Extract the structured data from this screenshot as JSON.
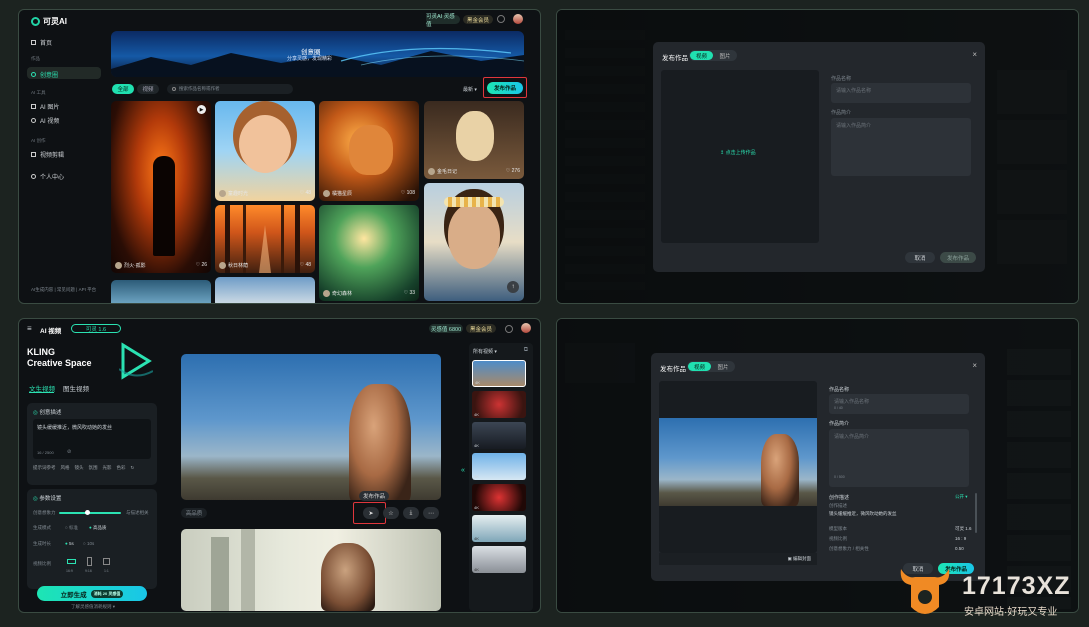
{
  "home": {
    "logo": "可灵AI",
    "header_pill1": "可灵AI 灵感值",
    "header_pill2": "黑金会员",
    "nav": [
      {
        "label": "首页"
      },
      {
        "label": "作品"
      },
      {
        "label": "创意圈"
      },
      {
        "label": "AI 工具"
      },
      {
        "label": "AI 图片"
      },
      {
        "label": "AI 视频"
      },
      {
        "label": "AI 创作"
      },
      {
        "label": "视频剪辑"
      },
      {
        "label": "个人中心"
      }
    ],
    "footer": "AI生成内容 | 常见问题 | API 平台",
    "banner_title": "创意圈",
    "banner_sub": "分享灵感，发现精彩",
    "tabs": [
      "全部",
      "视频"
    ],
    "search_placeholder": "搜索作品名称或作者",
    "sort_label": "最新",
    "publish_button": "发布作品",
    "cards": [
      {
        "author": "烈火·孤影",
        "likes": "26"
      },
      {
        "author": "童趣时光",
        "likes": "48"
      },
      {
        "author": "橘猫星辰",
        "likes": "108"
      },
      {
        "author": "金毛日记",
        "likes": "276"
      },
      {
        "author": "秋日林荫",
        "likes": "48"
      },
      {
        "author": "奇幻森林",
        "likes": "33"
      },
      {
        "author": "少年花冠",
        "likes": ""
      }
    ]
  },
  "publish_modal_empty": {
    "title": "发布作品",
    "tabs": [
      "视频",
      "图片"
    ],
    "upload_hint": "点击上传作品",
    "name_label": "作品名称",
    "name_placeholder": "请输入作品名称",
    "desc_label": "作品简介",
    "desc_placeholder": "请输入作品简介",
    "cancel": "取消",
    "submit": "发布作品"
  },
  "video_gen": {
    "menu_title": "AI 视频",
    "version_pill": "可灵 1.6",
    "header_pill1": "灵感值 6800",
    "header_pill2": "黑金会员",
    "brand_line1": "KLING",
    "brand_line2": "Creative Space",
    "tabs": [
      "文生视频",
      "图生视频"
    ],
    "prompt_section": "创意描述",
    "prompt_text": "镜头缓缓推近，微风吹动她的发丝",
    "prompt_counter": "16 / 2500",
    "hint_items": [
      "提示词参考",
      "风格",
      "镜头",
      "氛围",
      "光影",
      "色彩"
    ],
    "params_section": "参数设置",
    "param_creativity": "创意想象力",
    "param_creativity_value": "与描述相关",
    "param_mode": "生成模式",
    "mode_options": [
      "标准",
      "高品质"
    ],
    "param_duration": "生成时长",
    "duration_options": [
      "5s",
      "10s"
    ],
    "param_ratio": "视频比例",
    "ratio_options": [
      "16:9",
      "9:16",
      "1:1"
    ],
    "generate_button": "立即生成",
    "generate_cost": "消耗 20 灵感值",
    "footer_link": "了解灵感值消耗规则",
    "publish_tooltip": "发布作品",
    "video_tag": "高品质",
    "history_title": "所有视频",
    "thumb_tags": [
      "4K",
      "4K",
      "4K",
      "4K",
      "4K",
      "4K",
      "4K"
    ]
  },
  "publish_modal_filled": {
    "title": "发布作品",
    "tabs": [
      "视频",
      "图片"
    ],
    "name_label": "作品名称",
    "name_placeholder": "请输入作品名称",
    "name_counter": "0 / 40",
    "desc_label": "作品简介",
    "desc_placeholder": "请输入作品简介",
    "desc_counter": "0 / 500",
    "prompt_label": "创作描述",
    "prompt_toggle": "公开",
    "prompt_line1": "创作描述",
    "prompt_line2": "镜头缓缓推近，微风吹动她的发丝",
    "info_rows": [
      {
        "label": "模型版本",
        "value": "可灵 1.6"
      },
      {
        "label": "视频比例",
        "value": "16 : 9"
      },
      {
        "label": "创意想象力 / 相关性",
        "value": "0.50"
      }
    ],
    "cover_button": "编辑封面",
    "cancel": "取消",
    "submit": "发布作品"
  },
  "watermark": {
    "brand": "17173XZ",
    "sub": "安卓网站·好玩又专业"
  },
  "colors": {
    "accent": "#1de5b3",
    "highlight": "#e0363c",
    "panel_border": "#3a4b42"
  }
}
